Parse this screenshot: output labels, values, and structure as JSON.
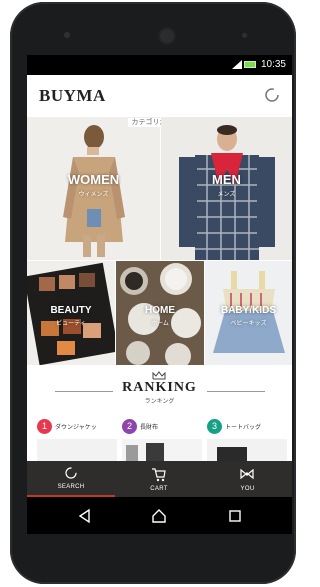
{
  "status": {
    "time": "10:35"
  },
  "app": {
    "logo": "BUYMA"
  },
  "category_header": "カテゴリから探す",
  "categories": [
    {
      "title": "WOMEN",
      "sub": "ウィメンズ"
    },
    {
      "title": "MEN",
      "sub": "メンズ"
    },
    {
      "title": "BEAUTY",
      "sub": "ビューティ"
    },
    {
      "title": "HOME",
      "sub": "ホーム"
    },
    {
      "title": "BABY/KIDS",
      "sub": "ベビーキッズ"
    }
  ],
  "ranking": {
    "title": "RANKING",
    "sub": "ランキング",
    "items": [
      {
        "rank": "1",
        "name": "ダウンジャケッ",
        "color": "#e8384f"
      },
      {
        "rank": "2",
        "name": "長財布",
        "color": "#8e44ad"
      },
      {
        "rank": "3",
        "name": "トートバッグ",
        "color": "#16a085"
      }
    ]
  },
  "tabs": [
    {
      "label": "SEARCH",
      "icon": "search-icon",
      "active": true
    },
    {
      "label": "CART",
      "icon": "cart-icon",
      "active": false
    },
    {
      "label": "YOU",
      "icon": "bow-icon",
      "active": false
    }
  ],
  "nav": {
    "back": "back-icon",
    "home": "home-icon",
    "recents": "recents-icon"
  },
  "colors": {
    "tabbar": "#2e2d2b",
    "tab_active": "#c0392b",
    "battery": "#7ed957"
  }
}
